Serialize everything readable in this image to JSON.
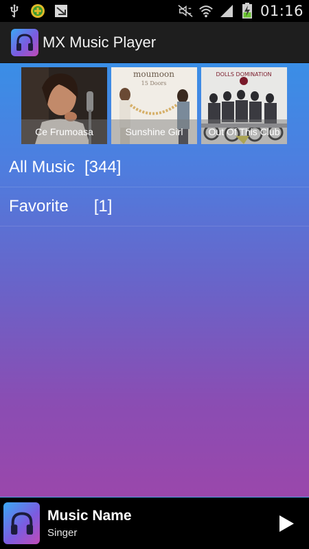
{
  "status_bar": {
    "time": "01:16",
    "left_icons": [
      "usb-icon",
      "android-update-icon",
      "download-icon"
    ],
    "right_icons": [
      "mute-icon",
      "wifi-icon",
      "signal-icon",
      "battery-charging-icon"
    ]
  },
  "app_bar": {
    "title": "MX Music Player",
    "logo_icon": "headphones-icon"
  },
  "albums": [
    {
      "label": "Ce Frumoasa"
    },
    {
      "label": "Sunshine Girl"
    },
    {
      "label": "Out Of This Club"
    }
  ],
  "menu": [
    {
      "label": "All Music",
      "count": "[344]"
    },
    {
      "label": "Favorite",
      "count": "[1]"
    }
  ],
  "now_playing": {
    "title": "Music Name",
    "artist": "Singer",
    "play_icon": "play-icon"
  },
  "colors": {
    "accent_blue": "#3a8ee6",
    "gradient_purple": "#9a47ab",
    "app_bar": "#1e1e1e"
  }
}
